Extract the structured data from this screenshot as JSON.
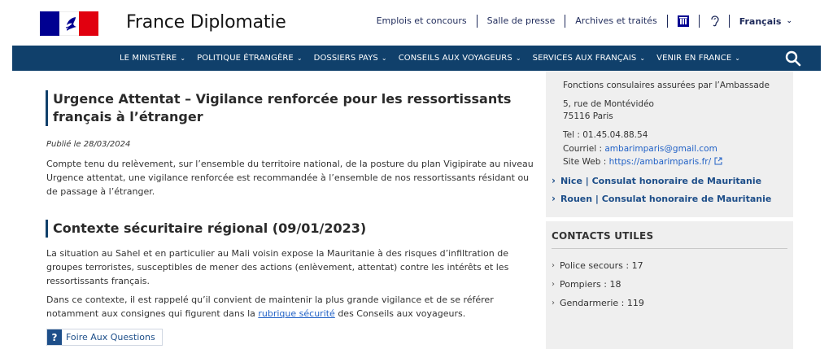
{
  "header": {
    "site_title": "France Diplomatie",
    "top_links": [
      "Emplois et concours",
      "Salle de presse",
      "Archives et traités"
    ],
    "language": "Français"
  },
  "nav": {
    "items": [
      {
        "label": "LE MINISTÈRE"
      },
      {
        "label": "POLITIQUE ÉTRANGÈRE"
      },
      {
        "label": "DOSSIERS PAYS"
      },
      {
        "label": "CONSEILS AUX VOYAGEURS"
      },
      {
        "label": "SERVICES AUX FRANÇAIS"
      },
      {
        "label": "VENIR EN FRANCE"
      }
    ],
    "search_icon": "search-icon"
  },
  "main": {
    "title1": "Urgence Attentat – Vigilance renforcée pour les ressortissants français à l’étranger",
    "published": "Publié le 28/03/2024",
    "para1": "Compte tenu du relèvement, sur l’ensemble du territoire national, de la posture du plan Vigipirate au niveau Urgence attentat, une vigilance renforcée est recommandée à l’ensemble de nos ressortissants résidant ou de passage à l’étranger.",
    "title2": "Contexte sécuritaire régional (09/01/2023)",
    "para2": "La situation au Sahel et en particulier au Mali voisin expose la Mauritanie à des risques d’infiltration de groupes terroristes, susceptibles de mener des actions (enlèvement, attentat) contre les intérêts et les ressortissants français.",
    "para3_before": "Dans ce contexte, il est rappelé qu’il convient de maintenir la plus grande vigilance et de se référer notamment aux consignes qui figurent dans la ",
    "para3_link": "rubrique sécurité",
    "para3_after": " des Conseils aux voyageurs.",
    "faq_label": "Foire Aux Questions"
  },
  "sidebar": {
    "consular_functions": "Fonctions consulaires assurées par l’Ambassade",
    "address_line1": "5, rue de Montévidéo",
    "address_line2": "75116 Paris",
    "tel": "Tel : 01.45.04.88.54",
    "email_label": "Courriel : ",
    "email": "ambarimparis@gmail.com",
    "web_label": "Site Web : ",
    "web": "https://ambarimparis.fr/",
    "links": [
      "Nice | Consulat honoraire de Mauritanie",
      "Rouen | Consulat honoraire de Mauritanie"
    ],
    "contacts_title": "CONTACTS UTILES",
    "contacts": [
      "Police secours : 17",
      "Pompiers : 18",
      "Gendarmerie : 119"
    ]
  },
  "colors": {
    "nav_bg": "#10406b",
    "link": "#2262c6",
    "flag_blue": "#000091",
    "flag_red": "#e1000f"
  }
}
